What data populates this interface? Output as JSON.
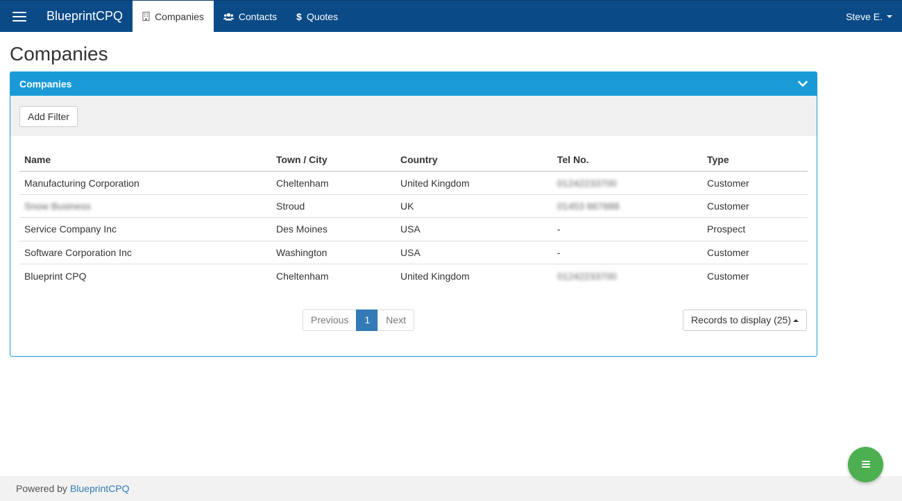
{
  "navbar": {
    "brand": "BlueprintCPQ",
    "items": [
      {
        "label": "Companies",
        "icon": "building-icon",
        "active": true
      },
      {
        "label": "Contacts",
        "icon": "users-icon",
        "active": false
      },
      {
        "label": "Quotes",
        "icon": "dollar-icon",
        "active": false
      }
    ],
    "user": "Steve E."
  },
  "page": {
    "title": "Companies"
  },
  "panel": {
    "title": "Companies",
    "add_filter_label": "Add Filter"
  },
  "table": {
    "headers": [
      "Name",
      "Town / City",
      "Country",
      "Tel No.",
      "Type"
    ],
    "rows": [
      {
        "name": "Manufacturing Corporation",
        "town": "Cheltenham",
        "country": "United Kingdom",
        "tel": "01242233700",
        "type": "Customer",
        "name_blurred": false,
        "tel_blurred": true
      },
      {
        "name": "Snow Business",
        "town": "Stroud",
        "country": "UK",
        "tel": "01453 667888",
        "type": "Customer",
        "name_blurred": true,
        "tel_blurred": true
      },
      {
        "name": "Service Company Inc",
        "town": "Des Moines",
        "country": "USA",
        "tel": "-",
        "type": "Prospect",
        "name_blurred": false,
        "tel_blurred": false
      },
      {
        "name": "Software Corporation Inc",
        "town": "Washington",
        "country": "USA",
        "tel": "-",
        "type": "Customer",
        "name_blurred": false,
        "tel_blurred": false
      },
      {
        "name": "Blueprint CPQ",
        "town": "Cheltenham",
        "country": "United Kingdom",
        "tel": "01242233700",
        "type": "Customer",
        "name_blurred": false,
        "tel_blurred": true
      }
    ]
  },
  "pagination": {
    "previous": "Previous",
    "current": "1",
    "next": "Next"
  },
  "records_to_display": "Records to display (25)",
  "footer": {
    "powered_by": "Powered by",
    "link": "BlueprintCPQ"
  },
  "colors": {
    "navbar": "#0a4a87",
    "panel_header": "#1a9bd7",
    "active_page": "#337ab7",
    "fab": "#4cb050"
  }
}
